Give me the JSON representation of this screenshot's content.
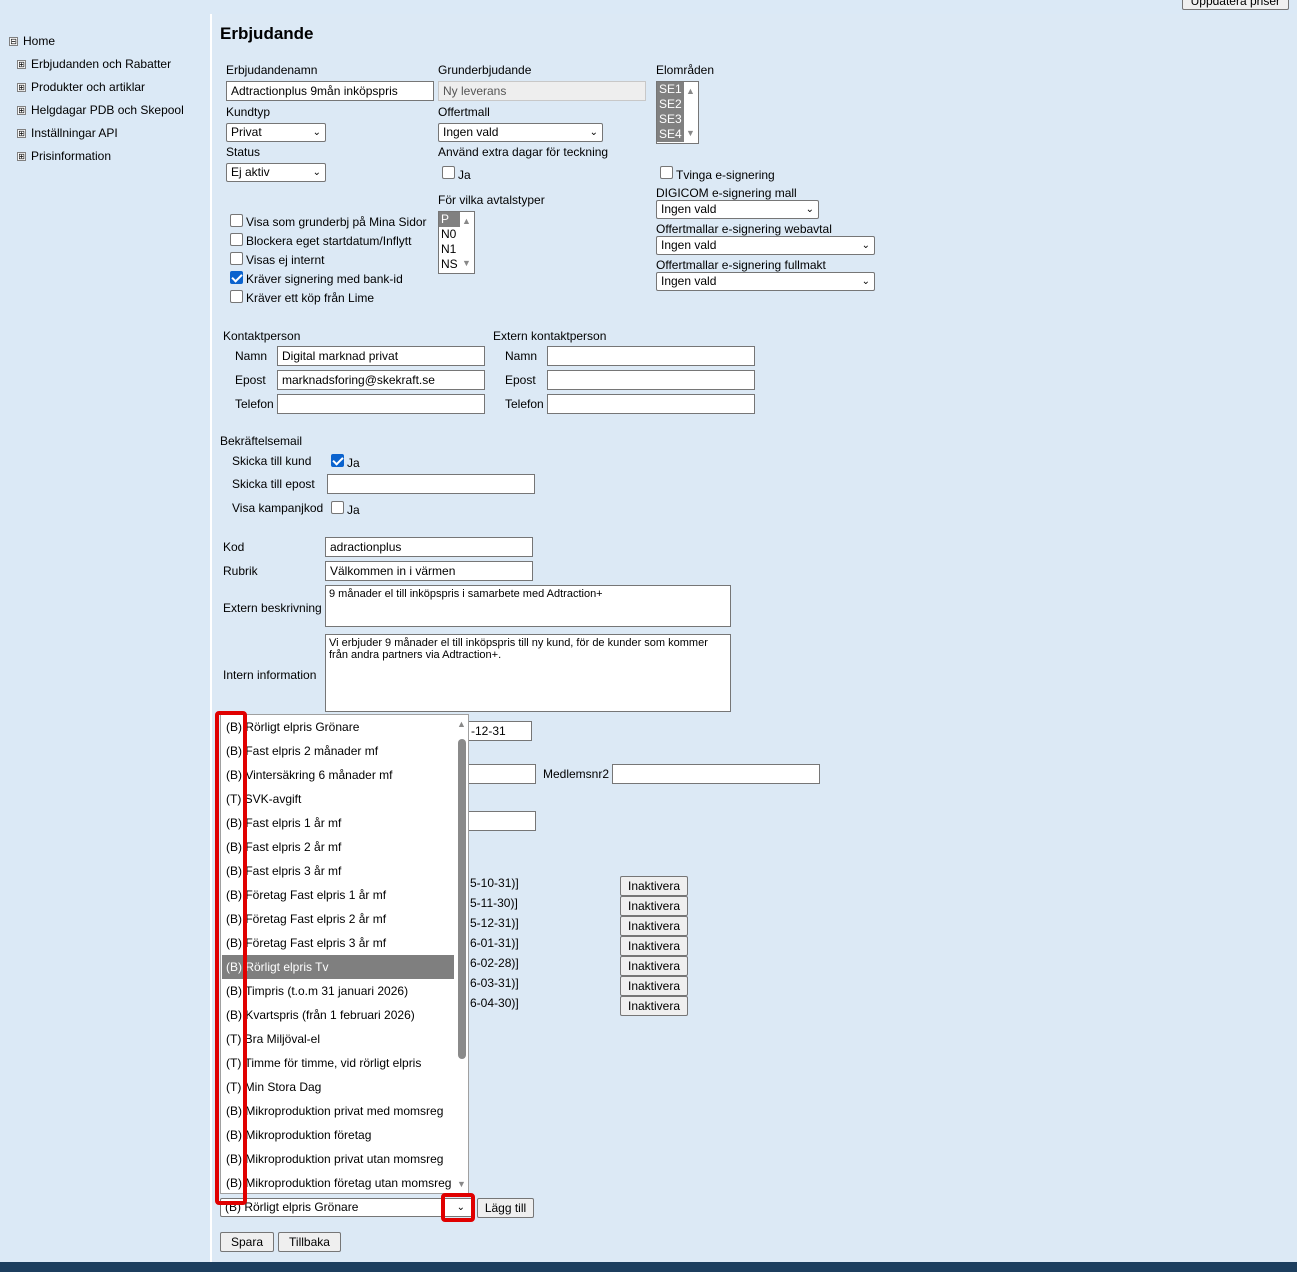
{
  "header": {
    "update_button": "Uppdatera priser"
  },
  "sidebar": {
    "items": [
      {
        "box": "⊟",
        "label": "Home"
      },
      {
        "box": "⊞",
        "label": "Erbjudanden och Rabatter"
      },
      {
        "box": "⊞",
        "label": "Produkter och artiklar"
      },
      {
        "box": "⊞",
        "label": "Helgdagar PDB och Skepool"
      },
      {
        "box": "⊞",
        "label": "Inställningar API"
      },
      {
        "box": "⊞",
        "label": "Prisinformation"
      }
    ]
  },
  "page": {
    "title": "Erbjudande"
  },
  "form": {
    "erbjudandenamn": {
      "label": "Erbjudandenamn",
      "value": "Adtractionplus 9mån inköpspris"
    },
    "grunderbjudande": {
      "label": "Grunderbjudande",
      "placeholder": "Ny leverans"
    },
    "elomraden": {
      "label": "Elområden",
      "options": [
        "SE1",
        "SE2",
        "SE3",
        "SE4"
      ]
    },
    "kundtyp": {
      "label": "Kundtyp",
      "value": "Privat"
    },
    "offertmall": {
      "label": "Offertmall",
      "value": "Ingen vald"
    },
    "status": {
      "label": "Status",
      "value": "Ej aktiv"
    },
    "extra_dagar": {
      "label": "Använd extra dagar för teckning",
      "checkbox_label": "Ja"
    },
    "tvinga": {
      "label": "Tvinga e-signering"
    },
    "digicom": {
      "label": "DIGICOM e-signering mall",
      "value": "Ingen vald"
    },
    "webavtal": {
      "label": "Offertmallar e-signering webavtal",
      "value": "Ingen vald"
    },
    "fullmakt": {
      "label": "Offertmallar e-signering fullmakt",
      "value": "Ingen vald"
    },
    "avtalstyper": {
      "label": "För vilka avtalstyper",
      "options": [
        "P",
        "N0",
        "N1",
        "NS"
      ]
    },
    "checks": [
      {
        "label": "Visa som grunderbj på Mina Sidor",
        "checked": false
      },
      {
        "label": "Blockera eget startdatum/Inflytt",
        "checked": false
      },
      {
        "label": "Visas ej internt",
        "checked": false
      },
      {
        "label": "Kräver signering med bank-id",
        "checked": true
      },
      {
        "label": "Kräver ett köp från Lime",
        "checked": false
      }
    ]
  },
  "contact": {
    "title": "Kontaktperson",
    "namn_label": "Namn",
    "namn": "Digital marknad privat",
    "epost_label": "Epost",
    "epost": "marknadsforing@skekraft.se",
    "telefon_label": "Telefon",
    "telefon": ""
  },
  "extern": {
    "title": "Extern kontaktperson",
    "namn_label": "Namn",
    "epost_label": "Epost",
    "telefon_label": "Telefon"
  },
  "confirm": {
    "title": "Bekräftelsemail",
    "skicka_kund_label": "Skicka till kund",
    "skicka_kund_check": "Ja",
    "skicka_epost_label": "Skicka till epost",
    "visa_kampanj_label": "Visa kampanjkod",
    "visa_kampanj_check": "Ja"
  },
  "details": {
    "kod_label": "Kod",
    "kod": "adractionplus",
    "rubrik_label": "Rubrik",
    "rubrik": "Välkommen in i värmen",
    "extern_label": "Extern beskrivning",
    "extern_text": "9 månader el till inköpspris i samarbete med Adtraction+",
    "intern_label": "Intern information",
    "intern_text": "Vi erbjuder 9 månader el till inköpspris till ny kund, för de kunder som kommer från andra partners via Adtraction+."
  },
  "partial": {
    "date_suffix": "-12-31",
    "medlemsnr2_label": "Medlemsnr2",
    "periods": [
      "5-10-31)]",
      "5-11-30)]",
      "5-12-31)]",
      "6-01-31)]",
      "6-02-28)]",
      "6-03-31)]",
      "6-04-30)]"
    ],
    "inaktivera": "Inaktivera"
  },
  "dropdown": {
    "items": [
      "(B) Rörligt elpris Grönare",
      "(B) Fast elpris 2 månader mf",
      "(B) Vintersäkring 6 månader mf",
      "(T) SVK-avgift",
      "(B) Fast elpris 1 år mf",
      "(B) Fast elpris 2 år mf",
      "(B) Fast elpris 3 år mf",
      "(B) Företag Fast elpris 1 år mf",
      "(B) Företag Fast elpris 2 år mf",
      "(B) Företag Fast elpris 3 år mf",
      "(B) Rörligt elpris Tv",
      "(B) Timpris (t.o.m 31 januari 2026)",
      "(B) Kvartspris (från 1 februari 2026)",
      "(T) Bra Miljöval-el",
      "(T) Timme för timme, vid rörligt elpris",
      "(T) Min Stora Dag",
      "(B) Mikroproduktion privat med momsreg",
      "(B) Mikroproduktion företag",
      "(B) Mikroproduktion privat utan momsreg",
      "(B) Mikroproduktion företag utan momsreg"
    ],
    "highlighted_index": 10,
    "selected": "(B) Rörligt elpris Grönare",
    "add_button": "Lägg till"
  },
  "actions": {
    "save": "Spara",
    "back": "Tillbaka"
  },
  "colors": {
    "sidebar_bg": "#dbe9f6",
    "main_bg": "#dce9f5",
    "highlight": "#e00000",
    "footer": "#1c3e5e"
  }
}
